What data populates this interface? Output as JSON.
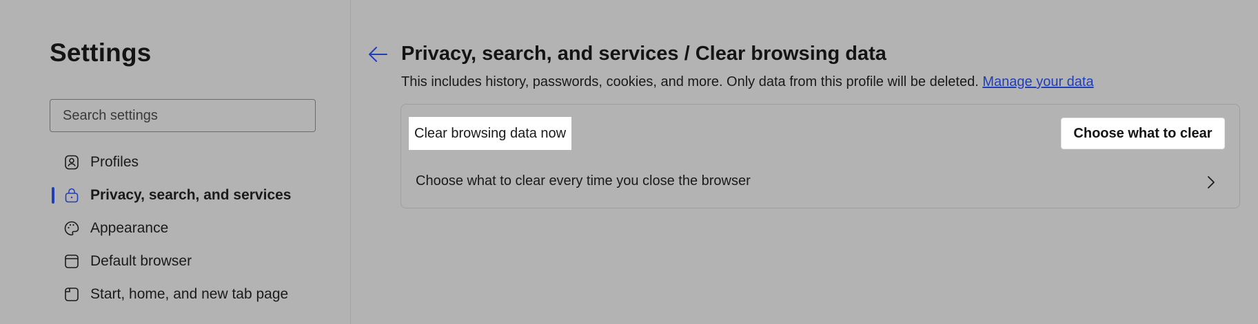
{
  "sidebar": {
    "title": "Settings",
    "search_placeholder": "Search settings",
    "items": [
      {
        "label": "Profiles",
        "icon": "profile-icon"
      },
      {
        "label": "Privacy, search, and services",
        "icon": "lock-icon",
        "active": true
      },
      {
        "label": "Appearance",
        "icon": "palette-icon"
      },
      {
        "label": "Default browser",
        "icon": "browser-icon"
      },
      {
        "label": "Start, home, and new tab page",
        "icon": "home-page-icon"
      }
    ]
  },
  "main": {
    "title": "Privacy, search, and services / Clear browsing data",
    "description": "This includes history, passwords, cookies, and more. Only data from this profile will be deleted.",
    "manage_link": "Manage your data",
    "card": {
      "row1_label": "Clear browsing data now",
      "row1_button": "Choose what to clear",
      "row2_label": "Choose what to clear every time you close the browser"
    }
  },
  "colors": {
    "background": "#b3b3b3",
    "accent": "#1f3fb8",
    "highlight": "#ffffff"
  }
}
